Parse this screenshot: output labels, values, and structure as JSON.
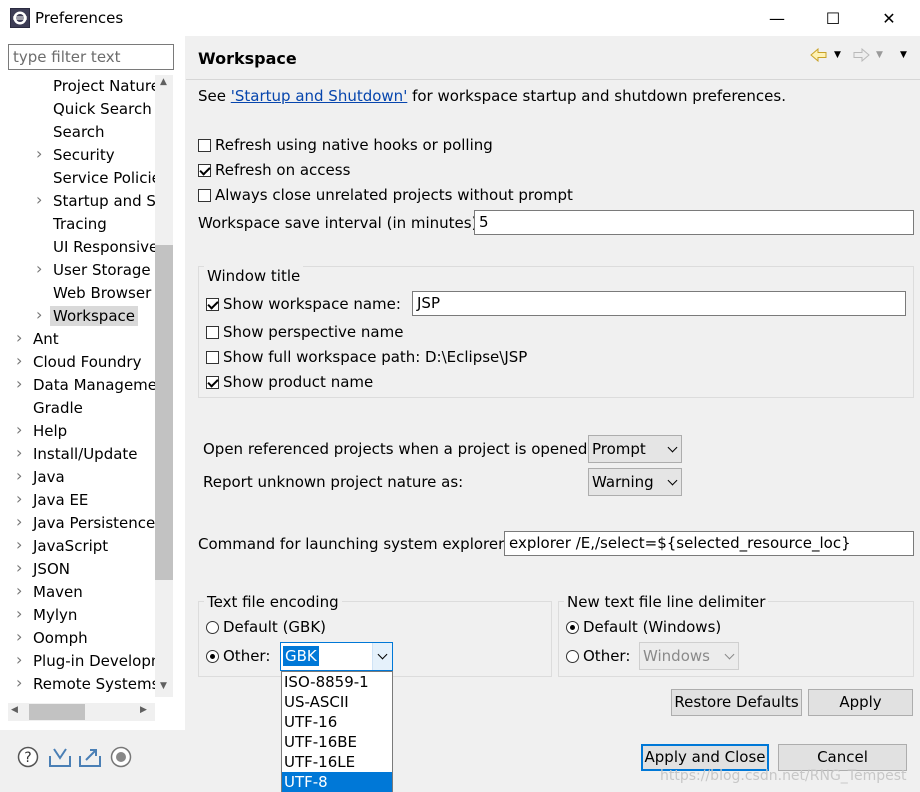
{
  "window": {
    "title": "Preferences",
    "minimize": "—",
    "maximize": "☐",
    "close": "✕"
  },
  "sidebar": {
    "filter_placeholder": "type filter text",
    "items": [
      {
        "label": "Project Natures",
        "expandable": false,
        "indent": 2
      },
      {
        "label": "Quick Search",
        "expandable": false,
        "indent": 2
      },
      {
        "label": "Search",
        "expandable": false,
        "indent": 2
      },
      {
        "label": "Security",
        "expandable": true,
        "indent": 2
      },
      {
        "label": "Service Policies",
        "expandable": false,
        "indent": 2
      },
      {
        "label": "Startup and Shutdown",
        "expandable": true,
        "indent": 2
      },
      {
        "label": "Tracing",
        "expandable": false,
        "indent": 2
      },
      {
        "label": "UI Responsiveness",
        "expandable": false,
        "indent": 2
      },
      {
        "label": "User Storage",
        "expandable": true,
        "indent": 2
      },
      {
        "label": "Web Browser",
        "expandable": false,
        "indent": 2
      },
      {
        "label": "Workspace",
        "expandable": true,
        "indent": 2,
        "selected": true
      },
      {
        "label": "Ant",
        "expandable": true,
        "indent": 1
      },
      {
        "label": "Cloud Foundry",
        "expandable": true,
        "indent": 1
      },
      {
        "label": "Data Management",
        "expandable": true,
        "indent": 1
      },
      {
        "label": "Gradle",
        "expandable": false,
        "indent": 1
      },
      {
        "label": "Help",
        "expandable": true,
        "indent": 1
      },
      {
        "label": "Install/Update",
        "expandable": true,
        "indent": 1
      },
      {
        "label": "Java",
        "expandable": true,
        "indent": 1
      },
      {
        "label": "Java EE",
        "expandable": true,
        "indent": 1
      },
      {
        "label": "Java Persistence",
        "expandable": true,
        "indent": 1
      },
      {
        "label": "JavaScript",
        "expandable": true,
        "indent": 1
      },
      {
        "label": "JSON",
        "expandable": true,
        "indent": 1
      },
      {
        "label": "Maven",
        "expandable": true,
        "indent": 1
      },
      {
        "label": "Mylyn",
        "expandable": true,
        "indent": 1
      },
      {
        "label": "Oomph",
        "expandable": true,
        "indent": 1
      },
      {
        "label": "Plug-in Development",
        "expandable": true,
        "indent": 1
      },
      {
        "label": "Remote Systems",
        "expandable": true,
        "indent": 1
      }
    ]
  },
  "page": {
    "title": "Workspace",
    "see_prefix": "See ",
    "see_link": "'Startup and Shutdown'",
    "see_suffix": " for workspace startup and shutdown preferences.",
    "opt_refresh_native": {
      "label": "Refresh using native hooks or polling",
      "checked": false
    },
    "opt_refresh_access": {
      "label": "Refresh on access",
      "checked": true
    },
    "opt_always_close": {
      "label": "Always close unrelated projects without prompt",
      "checked": false
    },
    "save_interval_label": "Workspace save interval (in minutes):",
    "save_interval_value": "5",
    "window_title_group": {
      "title": "Window title",
      "show_workspace_name": {
        "label": "Show workspace name:",
        "checked": true,
        "value": "JSP"
      },
      "show_perspective_name": {
        "label": "Show perspective name",
        "checked": false
      },
      "show_full_path": {
        "label": "Show full workspace path:",
        "checked": false,
        "value": "D:\\Eclipse\\JSP"
      },
      "show_product_name": {
        "label": "Show product name",
        "checked": true
      }
    },
    "open_referenced_label": "Open referenced projects when a project is opened:",
    "open_referenced_value": "Prompt",
    "unknown_nature_label": "Report unknown project nature as:",
    "unknown_nature_value": "Warning",
    "explorer_label": "Command for launching system explorer:",
    "explorer_value": "explorer /E,/select=${selected_resource_loc}",
    "encoding_group": {
      "title": "Text file encoding",
      "default_label": "Default (GBK)",
      "other_label": "Other:",
      "other_value": "GBK",
      "options": [
        "ISO-8859-1",
        "US-ASCII",
        "UTF-16",
        "UTF-16BE",
        "UTF-16LE",
        "UTF-8"
      ],
      "highlighted_option": "UTF-8"
    },
    "delimiter_group": {
      "title": "New text file line delimiter",
      "default_label": "Default (Windows)",
      "other_label": "Other:",
      "other_value": "Windows"
    },
    "restore_defaults": "Restore Defaults",
    "apply": "Apply"
  },
  "footer": {
    "apply_close": "Apply and Close",
    "cancel": "Cancel",
    "watermark": "https://blog.csdn.net/RNG_Tempest"
  },
  "icons": {
    "help": "help-icon",
    "import": "import-icon",
    "export": "export-icon",
    "record": "record-icon",
    "back": "back-arrow-icon",
    "forward": "forward-arrow-icon",
    "menu": "view-menu-icon"
  },
  "colors": {
    "accent": "#0078d7",
    "link": "#0645ad",
    "selection": "#0078d7"
  }
}
